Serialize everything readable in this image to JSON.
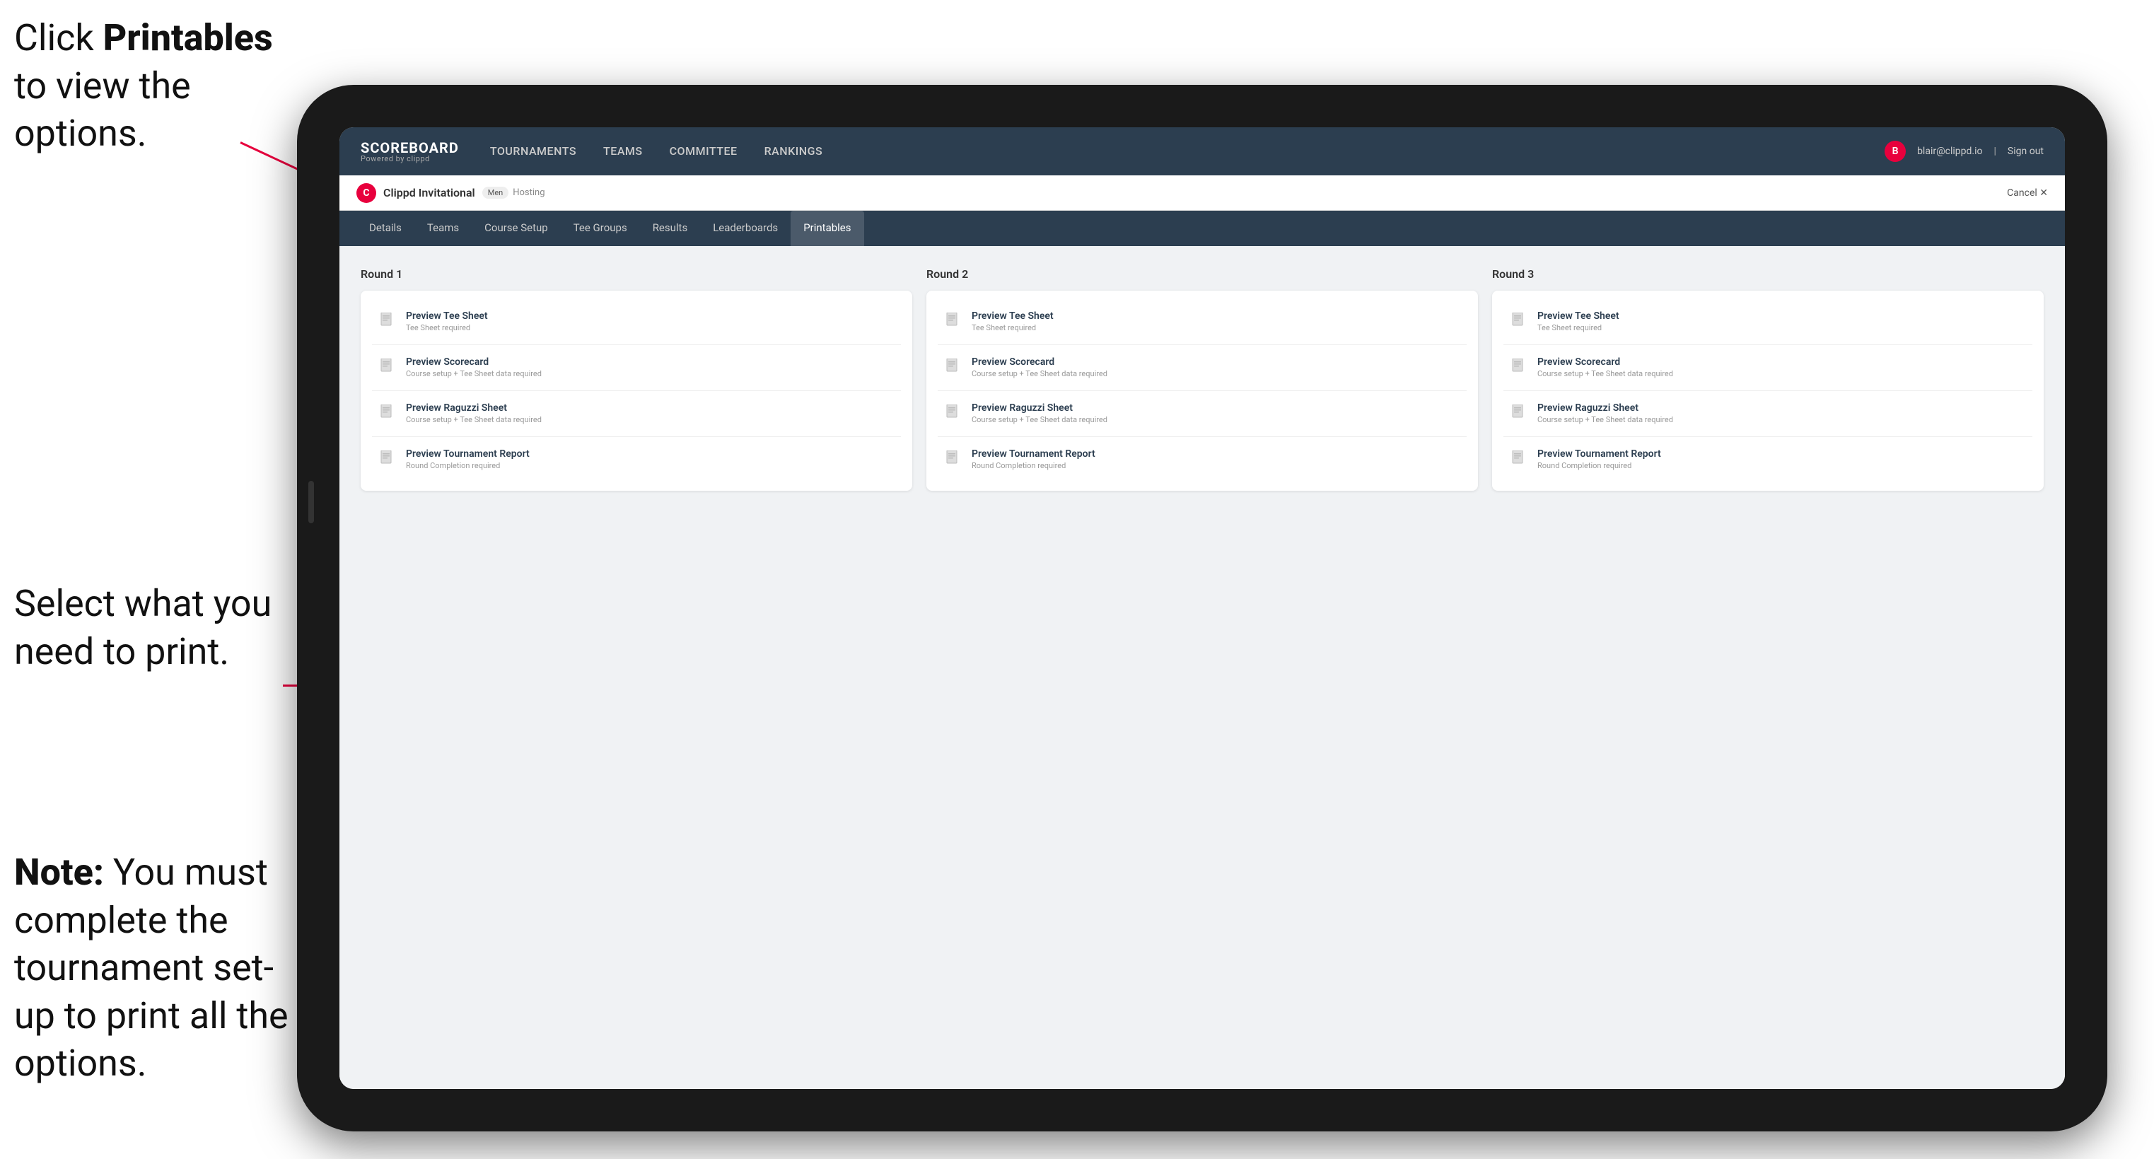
{
  "annotations": {
    "top": {
      "prefix": "Click ",
      "bold": "Printables",
      "suffix": " to view the options."
    },
    "mid": "Select what you need to print.",
    "bot": {
      "bold": "Note:",
      "suffix": " You must complete the tournament set-up to print all the options."
    }
  },
  "nav": {
    "logo_main": "SCOREBOARD",
    "logo_sub": "Powered by clippd",
    "links": [
      "TOURNAMENTS",
      "TEAMS",
      "COMMITTEE",
      "RANKINGS"
    ],
    "user_email": "blair@clippd.io",
    "sign_out": "Sign out"
  },
  "tournament": {
    "logo_letter": "C",
    "name": "Clippd Invitational",
    "badge": "Men",
    "status": "Hosting",
    "cancel": "Cancel ✕"
  },
  "sub_tabs": [
    "Details",
    "Teams",
    "Course Setup",
    "Tee Groups",
    "Results",
    "Leaderboards",
    "Printables"
  ],
  "active_tab": "Printables",
  "rounds": [
    {
      "title": "Round 1",
      "items": [
        {
          "title": "Preview Tee Sheet",
          "subtitle": "Tee Sheet required"
        },
        {
          "title": "Preview Scorecard",
          "subtitle": "Course setup + Tee Sheet data required"
        },
        {
          "title": "Preview Raguzzi Sheet",
          "subtitle": "Course setup + Tee Sheet data required"
        },
        {
          "title": "Preview Tournament Report",
          "subtitle": "Round Completion required"
        }
      ]
    },
    {
      "title": "Round 2",
      "items": [
        {
          "title": "Preview Tee Sheet",
          "subtitle": "Tee Sheet required"
        },
        {
          "title": "Preview Scorecard",
          "subtitle": "Course setup + Tee Sheet data required"
        },
        {
          "title": "Preview Raguzzi Sheet",
          "subtitle": "Course setup + Tee Sheet data required"
        },
        {
          "title": "Preview Tournament Report",
          "subtitle": "Round Completion required"
        }
      ]
    },
    {
      "title": "Round 3",
      "items": [
        {
          "title": "Preview Tee Sheet",
          "subtitle": "Tee Sheet required"
        },
        {
          "title": "Preview Scorecard",
          "subtitle": "Course setup + Tee Sheet data required"
        },
        {
          "title": "Preview Raguzzi Sheet",
          "subtitle": "Course setup + Tee Sheet data required"
        },
        {
          "title": "Preview Tournament Report",
          "subtitle": "Round Completion required"
        }
      ]
    }
  ]
}
